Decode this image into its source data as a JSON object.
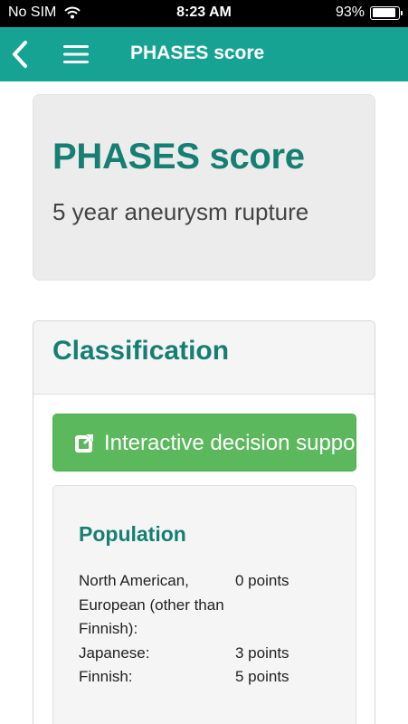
{
  "status_bar": {
    "carrier": "No SIM",
    "time": "8:23 AM",
    "battery_percent_text": "93%",
    "battery_level": 0.93
  },
  "nav": {
    "title": "PHASES score",
    "back_icon": "chevron-left-icon",
    "menu_icon": "hamburger-menu-icon"
  },
  "header": {
    "title": "PHASES score",
    "subtitle": "5 year aneurysm rupture"
  },
  "classification": {
    "title": "Classification",
    "decision_button": {
      "label": "Interactive decision support",
      "icon": "external-link-icon"
    },
    "population": {
      "title": "Population",
      "rows": [
        {
          "label": "North American, European (other than Finnish):",
          "points": "0 points"
        },
        {
          "label": "Japanese:",
          "points": "3 points"
        },
        {
          "label": "Finnish:",
          "points": "5 points"
        }
      ]
    }
  },
  "colors": {
    "nav_bar": "#17a393",
    "accent_text": "#167f73",
    "button_green": "#5cb85c",
    "panel_gray": "#ececec"
  }
}
